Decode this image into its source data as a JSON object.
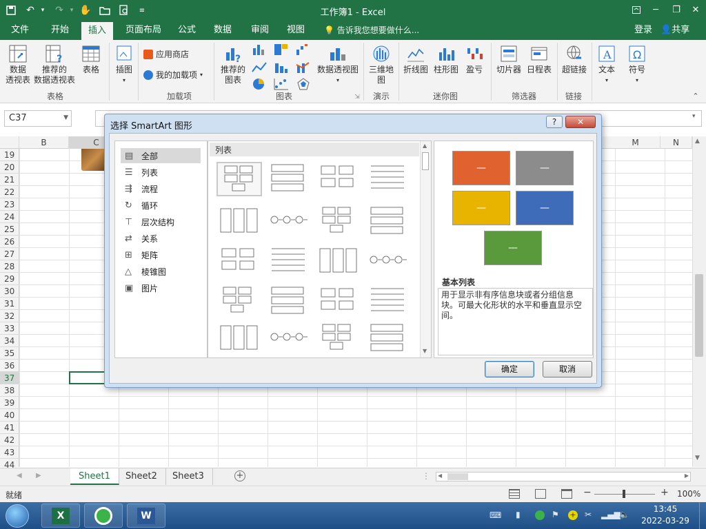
{
  "window": {
    "title": "工作簿1 - Excel",
    "quick_access_icons": [
      "save-icon",
      "undo-icon",
      "redo-icon",
      "touch-mode-icon",
      "open-icon",
      "print-preview-icon",
      "customize-icon"
    ]
  },
  "tabs": [
    "文件",
    "开始",
    "插入",
    "页面布局",
    "公式",
    "数据",
    "审阅",
    "视图"
  ],
  "active_tab": "插入",
  "tell_me": "告诉我您想要做什么...",
  "account": {
    "login": "登录",
    "share": "共享"
  },
  "ribbon": {
    "pivot": "数据\n透视表",
    "rec_pivot": "推荐的\n数据透视表",
    "table": "表格",
    "group_tables": "表格",
    "illustrations": "插图",
    "app_store": "应用商店",
    "my_addins": "我的加载项",
    "group_addins": "加载项",
    "rec_charts": "推荐的\n图表",
    "pivot_chart": "数据透视图",
    "group_charts": "图表",
    "map3d": "三维地\n图",
    "group_tours": "演示",
    "line": "折线图",
    "column": "柱形图",
    "winloss": "盈亏",
    "group_sparklines": "迷你图",
    "slicer": "切片器",
    "timeline": "日程表",
    "group_filters": "筛选器",
    "hyperlink": "超链接",
    "group_links": "链接",
    "text": "文本",
    "symbol": "符号"
  },
  "name_box": "C37",
  "columns": [
    "B",
    "C",
    "M",
    "N"
  ],
  "rows": [
    "19",
    "20",
    "21",
    "22",
    "23",
    "24",
    "25",
    "26",
    "27",
    "28",
    "29",
    "30",
    "31",
    "32",
    "33",
    "34",
    "35",
    "36",
    "37",
    "38",
    "39",
    "40",
    "41",
    "42",
    "43",
    "44"
  ],
  "sheets": [
    "Sheet1",
    "Sheet2",
    "Sheet3"
  ],
  "active_sheet": "Sheet1",
  "status": {
    "ready": "就绪",
    "zoom": "100%"
  },
  "taskbar": {
    "time": "13:45",
    "date": "2022-03-29"
  },
  "dialog": {
    "title": "选择 SmartArt 图形",
    "help": "?",
    "categories": [
      "全部",
      "列表",
      "流程",
      "循环",
      "层次结构",
      "关系",
      "矩阵",
      "棱锥图",
      "图片"
    ],
    "selected_category": "全部",
    "gallery_header": "列表",
    "preview_name": "基本列表",
    "preview_desc": "用于显示非有序信息块或者分组信息块。可最大化形状的水平和垂直显示空间。",
    "ok": "确定",
    "cancel": "取消",
    "preview_colors": [
      "#e0622e",
      "#8c8c8c",
      "#e8b400",
      "#3e6cb8",
      "#5a9a3c"
    ]
  }
}
